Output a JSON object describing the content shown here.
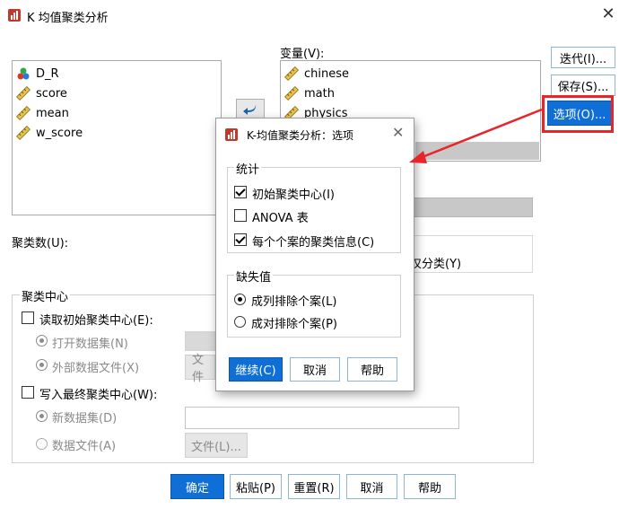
{
  "window": {
    "title": "K 均值聚类分析",
    "close_glyph": "✕"
  },
  "source_vars": [
    {
      "name": "D_R",
      "icon": "nominal-icon"
    },
    {
      "name": "score",
      "icon": "scale-icon"
    },
    {
      "name": "mean",
      "icon": "scale-icon"
    },
    {
      "name": "w_score",
      "icon": "scale-icon"
    }
  ],
  "variables_label": "变量(V):",
  "target_vars": [
    {
      "name": "chinese",
      "icon": "scale-icon"
    },
    {
      "name": "math",
      "icon": "scale-icon"
    },
    {
      "name": "physics",
      "icon": "scale-icon"
    }
  ],
  "side_buttons": {
    "iterate": "迭代(I)...",
    "save": "保存(S)...",
    "options": "选项(O)..."
  },
  "clusters_label": "聚类数(U):",
  "classify_only": "仅分类(Y)",
  "cluster_centers": {
    "title": "聚类中心",
    "read_initial": "读取初始聚类中心(E):",
    "open_dataset": "打开数据集(N)",
    "external_file": "外部数据文件(X)",
    "file_btn_1": "文件",
    "write_final": "写入最终聚类中心(W):",
    "new_dataset": "新数据集(D)",
    "data_file": "数据文件(A)",
    "file_btn_2": "文件(L)..."
  },
  "bottom_buttons": {
    "ok": "确定",
    "paste": "粘贴(P)",
    "reset": "重置(R)",
    "cancel": "取消",
    "help": "帮助"
  },
  "options_dialog": {
    "title": "K-均值聚类分析：选项",
    "close_glyph": "✕",
    "stats_title": "统计",
    "initial_centers": "初始聚类中心(I)",
    "initial_centers_checked": true,
    "anova": "ANOVA 表",
    "anova_checked": false,
    "cluster_info": "每个个案的聚类信息(C)",
    "cluster_info_checked": true,
    "missing_title": "缺失值",
    "listwise": "成列排除个案(L)",
    "pairwise": "成对排除个案(P)",
    "continue": "继续(C)",
    "cancel": "取消",
    "help": "帮助"
  },
  "colors": {
    "accent_blue": "#0f6fd6",
    "highlight_red": "#e8262a"
  }
}
